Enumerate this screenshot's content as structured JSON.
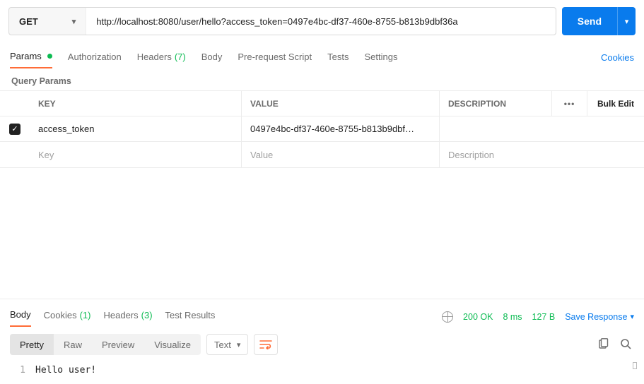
{
  "request": {
    "method": "GET",
    "url": "http://localhost:8080/user/hello?access_token=0497e4bc-df37-460e-8755-b813b9dbf36a",
    "send_label": "Send"
  },
  "tabs": {
    "params": "Params",
    "authorization": "Authorization",
    "headers": "Headers",
    "headers_count": "(7)",
    "body": "Body",
    "prerequest": "Pre-request Script",
    "tests": "Tests",
    "settings": "Settings",
    "cookies": "Cookies"
  },
  "query_params": {
    "heading": "Query Params",
    "columns": {
      "key": "KEY",
      "value": "VALUE",
      "description": "DESCRIPTION",
      "bulk": "Bulk Edit"
    },
    "rows": [
      {
        "checked": true,
        "key": "access_token",
        "value": "0497e4bc-df37-460e-8755-b813b9dbf…",
        "description": ""
      }
    ],
    "placeholders": {
      "key": "Key",
      "value": "Value",
      "description": "Description"
    }
  },
  "response": {
    "tabs": {
      "body": "Body",
      "cookies": "Cookies",
      "cookies_count": "(1)",
      "headers": "Headers",
      "headers_count": "(3)",
      "test_results": "Test Results"
    },
    "status": {
      "code": "200 OK",
      "time": "8 ms",
      "size": "127 B"
    },
    "save_label": "Save Response",
    "viewer": {
      "tabs": {
        "pretty": "Pretty",
        "raw": "Raw",
        "preview": "Preview",
        "visualize": "Visualize"
      },
      "type": "Text"
    },
    "body_lines": [
      "Hello user!"
    ]
  }
}
